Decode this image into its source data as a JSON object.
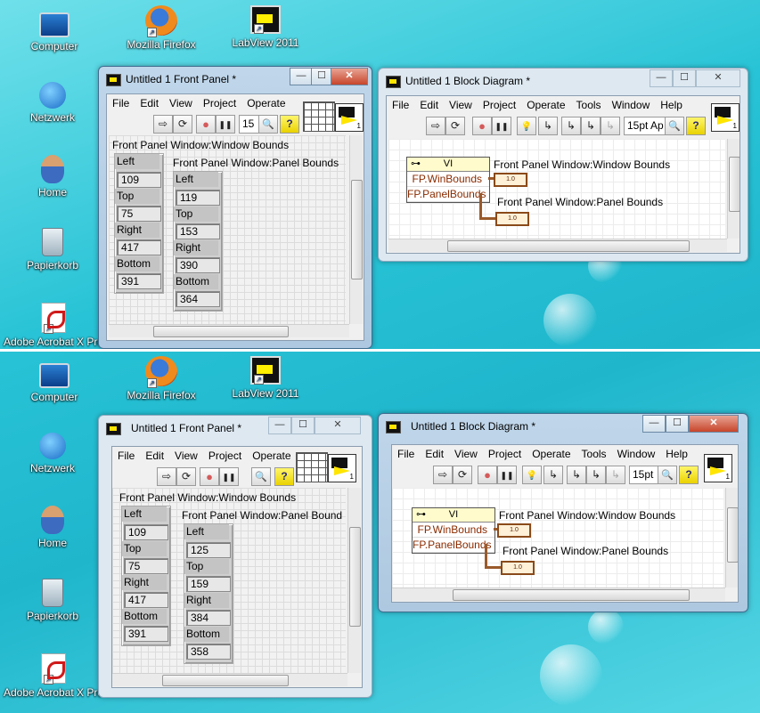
{
  "desktop": {
    "icons": [
      {
        "label": "Computer",
        "icon": "computer-icon"
      },
      {
        "label": "Mozilla Firefox",
        "icon": "firefox-icon"
      },
      {
        "label": "LabView 2011",
        "icon": "labview-icon"
      },
      {
        "label": "Netzwerk",
        "icon": "network-icon"
      },
      {
        "label": "Home",
        "icon": "home-user-icon"
      },
      {
        "label": "Papierkorb",
        "icon": "recycle-bin-icon"
      },
      {
        "label": "Adobe Acrobat X Pro",
        "icon": "acrobat-icon"
      }
    ]
  },
  "captures": [
    {
      "front_panel": {
        "title": "Untitled 1 Front Panel *",
        "menu": [
          "File",
          "Edit",
          "View",
          "Project",
          "Operate"
        ],
        "font_field": "15",
        "window_bounds": {
          "label": "Front Panel Window:Window Bounds",
          "fields": [
            {
              "name": "Left",
              "value": "109"
            },
            {
              "name": "Top",
              "value": "75"
            },
            {
              "name": "Right",
              "value": "417"
            },
            {
              "name": "Bottom",
              "value": "391"
            }
          ]
        },
        "panel_bounds": {
          "label": "Front Panel Window:Panel Bounds",
          "fields": [
            {
              "name": "Left",
              "value": "119"
            },
            {
              "name": "Top",
              "value": "153"
            },
            {
              "name": "Right",
              "value": "390"
            },
            {
              "name": "Bottom",
              "value": "364"
            }
          ]
        }
      },
      "block_diagram": {
        "title": "Untitled 1 Block Diagram *",
        "menu": [
          "File",
          "Edit",
          "View",
          "Project",
          "Operate",
          "Tools",
          "Window",
          "Help"
        ],
        "font_field": "15pt Ap",
        "node_title": "VI",
        "props": [
          "FP.WinBounds",
          "FP.PanelBounds"
        ],
        "indicator_labels": [
          "Front Panel Window:Window Bounds",
          "Front Panel Window:Panel Bounds"
        ]
      }
    },
    {
      "front_panel": {
        "title": "Untitled 1 Front Panel *",
        "menu": [
          "File",
          "Edit",
          "View",
          "Project",
          "Operate"
        ],
        "window_bounds": {
          "label": "Front Panel Window:Window Bounds",
          "fields": [
            {
              "name": "Left",
              "value": "109"
            },
            {
              "name": "Top",
              "value": "75"
            },
            {
              "name": "Right",
              "value": "417"
            },
            {
              "name": "Bottom",
              "value": "391"
            }
          ]
        },
        "panel_bounds": {
          "label": "Front Panel Window:Panel Bound",
          "fields": [
            {
              "name": "Left",
              "value": "125"
            },
            {
              "name": "Top",
              "value": "159"
            },
            {
              "name": "Right",
              "value": "384"
            },
            {
              "name": "Bottom",
              "value": "358"
            }
          ]
        }
      },
      "block_diagram": {
        "title": "Untitled 1 Block Diagram *",
        "menu": [
          "File",
          "Edit",
          "View",
          "Project",
          "Operate",
          "Tools",
          "Window",
          "Help"
        ],
        "font_field": "15pt",
        "node_title": "VI",
        "props": [
          "FP.WinBounds",
          "FP.PanelBounds"
        ],
        "indicator_labels": [
          "Front Panel Window:Window Bounds",
          "Front Panel Window:Panel Bounds"
        ]
      }
    }
  ],
  "captions": {
    "minimize": "—",
    "maximize": "☐",
    "close": "✕",
    "indicator": "1.0"
  }
}
